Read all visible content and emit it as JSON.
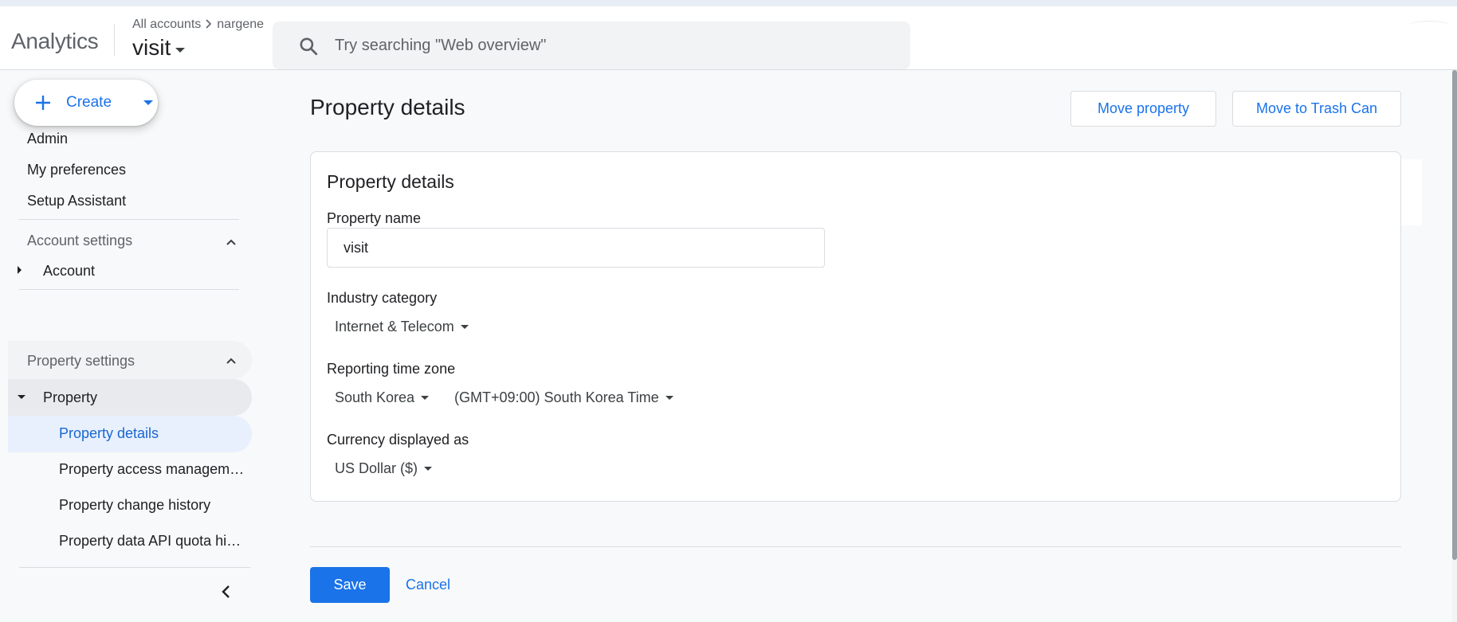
{
  "app": {
    "brand": "Analytics",
    "breadcrumb": {
      "root": "All accounts",
      "account": "nargene"
    },
    "property_selector": "visit"
  },
  "search": {
    "placeholder": "Try searching \"Web overview\"",
    "value": ""
  },
  "sidebar": {
    "create_label": "Create",
    "top_items": [
      "Admin",
      "My preferences",
      "Setup Assistant"
    ],
    "account_settings": {
      "header": "Account settings",
      "item": "Account"
    },
    "property_settings": {
      "header": "Property settings",
      "item": "Property",
      "children": [
        "Property details",
        "Property access management",
        "Property change history",
        "Property data API quota history"
      ],
      "active_child": "Property details"
    }
  },
  "main": {
    "title": "Property details",
    "actions": {
      "move": "Move property",
      "trash": "Move to Trash Can"
    },
    "card": {
      "title": "Property details",
      "property_name_label": "Property name",
      "property_name_value": "visit",
      "industry_label": "Industry category",
      "industry_value": "Internet & Telecom",
      "timezone_label": "Reporting time zone",
      "timezone_country": "South Korea",
      "timezone_value": "(GMT+09:00) South Korea Time",
      "currency_label": "Currency displayed as",
      "currency_value": "US Dollar ($)"
    },
    "footer": {
      "save": "Save",
      "cancel": "Cancel"
    }
  },
  "colors": {
    "accent": "#1a73e8",
    "active_nav_bg": "#e8f0fe",
    "active_nav_text": "#1967d2",
    "page_bg": "#f8f9fa"
  }
}
